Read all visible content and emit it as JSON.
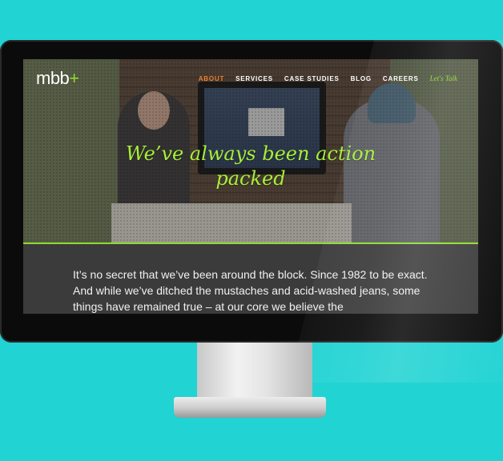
{
  "logo": {
    "text": "mbb",
    "plus": "+"
  },
  "nav": {
    "items": [
      "ABOUT",
      "SERVICES",
      "CASE STUDIES",
      "BLOG",
      "CAREERS"
    ],
    "active_index": 0,
    "cta": "Let's Talk"
  },
  "hero": {
    "title_line1": "We’ve always been action",
    "title_line2": "packed"
  },
  "intro": {
    "text": "It’s no secret that we’ve been around the block. Since 1982 to be exact. And while we’ve ditched the mustaches and acid-washed jeans, some things have remained true – at our core we believe the"
  },
  "colors": {
    "background": "#22d3d3",
    "accent_green": "#8fdc2c",
    "active_orange": "#ee7f2b"
  }
}
